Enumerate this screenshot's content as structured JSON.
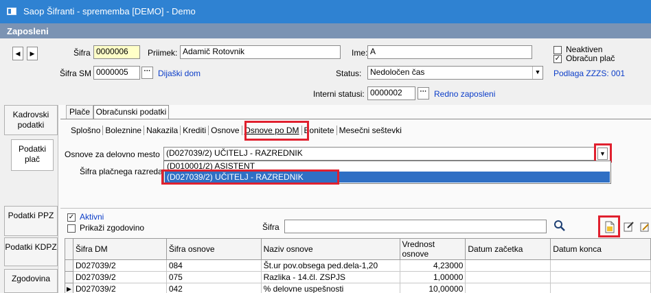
{
  "window": {
    "title": "Saop Šifranti - sprememba [DEMO] - Demo"
  },
  "section": {
    "title": "Zaposleni"
  },
  "header": {
    "sifra_label": "Šifra",
    "sifra_value": "0000006",
    "priimek_label": "Priimek:",
    "priimek_value": "Adamič Rotovnik",
    "ime_label": "Ime:",
    "ime_value": "A",
    "neaktiven_label": "Neaktiven",
    "obracun_label": "Obračun plač",
    "sifra_sm_label": "Šifra SM",
    "sifra_sm_value": "0000005",
    "sifra_sm_link": "Dijaški dom",
    "status_label": "Status:",
    "status_value": "Nedoločen čas",
    "podlaga_link": "Podlaga ZZZS: 001",
    "interni_label": "Interni statusi:",
    "interni_value": "0000002",
    "interni_link": "Redno zaposleni"
  },
  "left_nav": [
    {
      "label": "Kadrovski podatki"
    },
    {
      "label": "Podatki plač"
    },
    {
      "label": "Podatki PPZ"
    },
    {
      "label": "Podatki KDPZ"
    },
    {
      "label": "Zgodovina"
    }
  ],
  "main_tabs": [
    "Plače",
    "Obračunski podatki"
  ],
  "sub_tabs": [
    "Splošno",
    "Boleznine",
    "Nakazila",
    "Krediti",
    "Osnove",
    "Osnove po DM",
    "Bonitete",
    "Mesečni seštevki"
  ],
  "osnove": {
    "label": "Osnove  za delovno mesto",
    "selected": "(D027039/2) UČITELJ - RAZREDNIK",
    "options": [
      "(D010001/2) ASISTENT",
      "(D027039/2) UČITELJ - RAZREDNIK"
    ],
    "sifra_razreda_label": "Šifra plačnega razreda"
  },
  "filters": {
    "aktivni_label": "Aktivni",
    "zgodovina_label": "Prikaži zgodovino",
    "sifra_label": "Šifra",
    "sifra_value": ""
  },
  "table": {
    "columns": [
      "Šifra DM",
      "Šifra osnove",
      "Naziv osnove",
      "Vrednost osnove",
      "Datum začetka",
      "Datum konca"
    ],
    "rows": [
      [
        "D027039/2",
        "084",
        "Št.ur pov.obsega ped.dela-1,20",
        "4,23000",
        "",
        ""
      ],
      [
        "D027039/2",
        "075",
        "Razlika - 14.čl. ZSPJS",
        "1,00000",
        "",
        ""
      ],
      [
        "D027039/2",
        "042",
        "% delovne uspešnosti",
        "10,00000",
        "",
        ""
      ]
    ]
  }
}
